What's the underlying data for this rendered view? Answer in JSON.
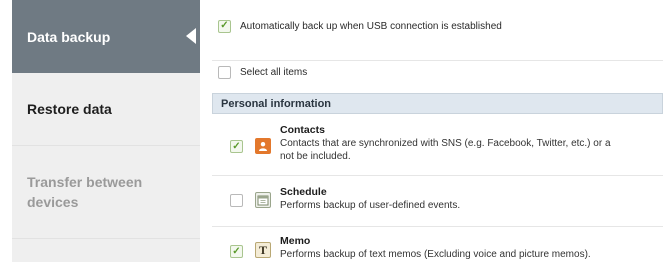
{
  "sidebar": {
    "items": [
      {
        "label": "Data backup",
        "state": "active"
      },
      {
        "label": "Restore data",
        "state": "normal"
      },
      {
        "label": "Transfer between devices",
        "state": "disabled"
      }
    ]
  },
  "backup": {
    "auto_backup_label": "Automatically back up when USB connection is established",
    "auto_backup_checked": true,
    "select_all_label": "Select all items",
    "select_all_checked": false,
    "section_title": "Personal information",
    "items": [
      {
        "title": "Contacts",
        "description_line1": "Contacts that are synchronized with SNS (e.g. Facebook, Twitter, etc.) or a",
        "description_line2": "not be included.",
        "checked": true,
        "icon": "contacts-icon"
      },
      {
        "title": "Schedule",
        "description_line1": "Performs backup of user-defined events.",
        "checked": false,
        "icon": "calendar-icon"
      },
      {
        "title": "Memo",
        "description_line1": "Performs backup of text memos (Excluding voice and picture memos).",
        "checked": true,
        "icon": "memo-icon"
      }
    ]
  },
  "colors": {
    "sidebar_active": "#6f7a83",
    "sidebar_inactive": "#efefef",
    "section_header_bg": "#dfe7ef",
    "check_green": "#5a9a2b"
  }
}
